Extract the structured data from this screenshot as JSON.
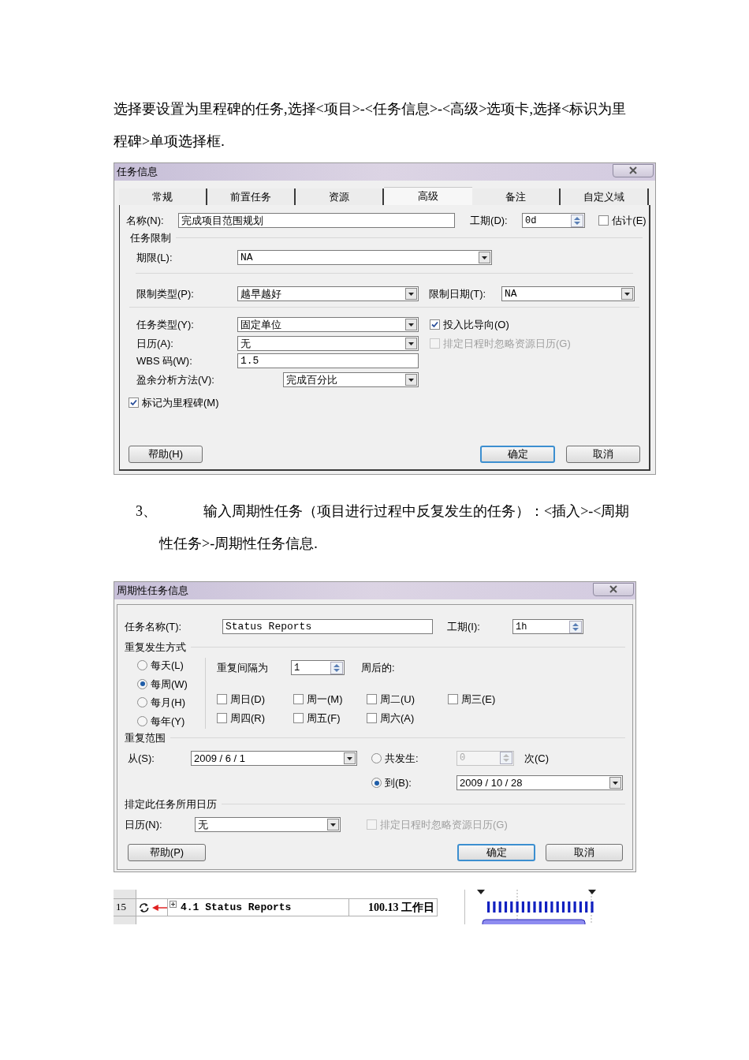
{
  "paragraph_1": "选择要设置为里程碑的任务,选择<项目>-<任务信息>-<高级>选项卡,选择<标识为里程碑>单项选择框.",
  "task_info_dialog": {
    "title": "任务信息",
    "tabs": [
      {
        "label": "常规",
        "selected": false
      },
      {
        "label": "前置任务",
        "selected": false
      },
      {
        "label": "资源",
        "selected": false
      },
      {
        "label": "高级",
        "selected": true
      },
      {
        "label": "备注",
        "selected": false
      },
      {
        "label": "自定义域",
        "selected": false
      }
    ],
    "name": {
      "label": "名称(N):",
      "value": "完成项目范围规划"
    },
    "duration": {
      "label": "工期(D):",
      "value": "0d"
    },
    "estimated": {
      "label": "估计(E)",
      "checked": false
    },
    "constraints_heading": "任务限制",
    "deadline": {
      "label": "期限(L):",
      "value": "NA"
    },
    "constraint_type": {
      "label": "限制类型(P):",
      "value": "越早越好"
    },
    "constraint_date": {
      "label": "限制日期(T):",
      "value": "NA"
    },
    "task_type": {
      "label": "任务类型(Y):",
      "value": "固定单位"
    },
    "effort_driven": {
      "label": "投入比导向(O)",
      "checked": true,
      "disabled": false
    },
    "calendar": {
      "label": "日历(A):",
      "value": "无"
    },
    "ignore_resource_calendars": {
      "label": "排定日程时忽略资源日历(G)",
      "checked": false,
      "disabled": true
    },
    "wbs_code": {
      "label": "WBS 码(W):",
      "value": "1.5"
    },
    "earned_value_method": {
      "label": "盈余分析方法(V):",
      "value": "完成百分比"
    },
    "mark_as_milestone": {
      "label": "标记为里程碑(M)",
      "checked": true,
      "disabled": false
    },
    "buttons": [
      {
        "label": "帮助(H)",
        "default": false
      },
      {
        "label": "确定",
        "default": true
      },
      {
        "label": "取消",
        "default": false
      }
    ]
  },
  "item_number": "3、",
  "paragraph_2": "输入周期性任务（项目进行过程中反复发生的任务）：<插入>-<周期性任务>-周期性任务信息.",
  "recurring_task_dialog": {
    "title": "周期性任务信息",
    "task_name": {
      "label": "任务名称(T):",
      "value": "Status Reports"
    },
    "duration": {
      "label": "工期(I):",
      "value": "1h"
    },
    "recurrence_heading": "重复发生方式",
    "patterns": [
      {
        "label": "每天(L)",
        "selected": false
      },
      {
        "label": "每周(W)",
        "selected": true
      },
      {
        "label": "每月(H)",
        "selected": false
      },
      {
        "label": "每年(Y)",
        "selected": false
      }
    ],
    "interval_label": "重复间隔为",
    "interval_value": "1",
    "interval_suffix": "周后的:",
    "weekdays": [
      {
        "label": "周日(D)",
        "checked": false
      },
      {
        "label": "周一(M)",
        "checked": false
      },
      {
        "label": "周二(U)",
        "checked": false
      },
      {
        "label": "周三(E)",
        "checked": false
      },
      {
        "label": "周四(R)",
        "checked": false
      },
      {
        "label": "周五(F)",
        "checked": false
      },
      {
        "label": "周六(A)",
        "checked": false
      }
    ],
    "range_heading": "重复范围",
    "from": {
      "label": "从(S):",
      "value": "2009 / 6 / 1"
    },
    "end_options": [
      {
        "label": "共发生:",
        "selected": false,
        "value": "0",
        "suffix": "次(C)"
      },
      {
        "label": "到(B):",
        "selected": true,
        "value": "2009 / 10 / 28"
      }
    ],
    "calendar_heading": "排定此任务所用日历",
    "calendar": {
      "label": "日历(N):",
      "value": "无"
    },
    "ignore_resource_calendars": {
      "label": "排定日程时忽略资源日历(G)",
      "checked": false,
      "disabled": true
    },
    "buttons": [
      {
        "label": "帮助(P)",
        "default": false
      },
      {
        "label": "确定",
        "default": true
      },
      {
        "label": "取消",
        "default": false
      }
    ]
  },
  "gantt_excerpt": {
    "row": {
      "id": "15",
      "name": "4.1 Status Reports",
      "duration": "100.13 工作日"
    }
  }
}
